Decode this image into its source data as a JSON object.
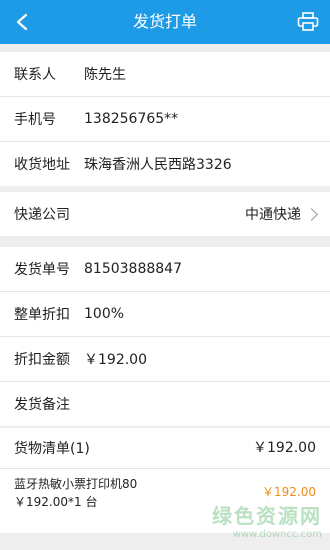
{
  "header": {
    "title": "发货打单",
    "back_icon": "back-chevron",
    "print_icon": "printer"
  },
  "contact": {
    "name_label": "联系人",
    "name_value": "陈先生",
    "phone_label": "手机号",
    "phone_value": "138256765**",
    "address_label": "收货地址",
    "address_value": "珠海香洲人民西路3326"
  },
  "express": {
    "label": "快递公司",
    "value": "中通快递"
  },
  "order": {
    "number_label": "发货单号",
    "number_value": "81503888847",
    "discount_label": "整单折扣",
    "discount_value": "100%",
    "amount_label": "折扣金额",
    "amount_value": "￥192.00",
    "note_label": "发货备注",
    "note_value": ""
  },
  "goods": {
    "title": "货物清单(1)",
    "total": "￥192.00",
    "items": [
      {
        "name": "蓝牙热敏小票打印机80",
        "detail": "￥192.00*1 台",
        "price": "￥192.00"
      }
    ]
  },
  "watermark": {
    "cn": "绿色资源网",
    "en": "www.downcc.com"
  },
  "colors": {
    "header": "#1e9be6",
    "price_accent": "#f08c1a"
  }
}
